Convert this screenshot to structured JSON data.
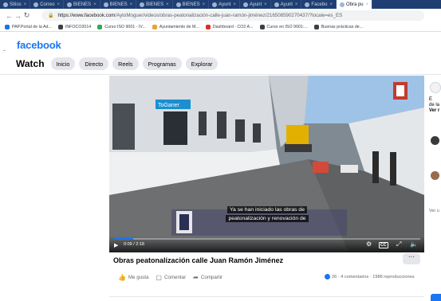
{
  "browser": {
    "tabs": [
      {
        "label": "Sitios",
        "active": false
      },
      {
        "label": "Correo",
        "active": false
      },
      {
        "label": "BIENES",
        "active": false
      },
      {
        "label": "BIENES",
        "active": false
      },
      {
        "label": "BIENES",
        "active": false
      },
      {
        "label": "BIENES",
        "active": false
      },
      {
        "label": "Ayunt",
        "active": false
      },
      {
        "label": "Ayunt",
        "active": false
      },
      {
        "label": "Ayunt",
        "active": false
      },
      {
        "label": "Facebo",
        "active": false
      },
      {
        "label": "Obra pu",
        "active": true
      }
    ],
    "url_host": "https://www.facebook.com",
    "url_path": "/AytoMoguer/videos/obras-peatonalización-calle-juan-ramón-jiménez/2165085902704​37/?locale=es_ES",
    "bookmarks": [
      {
        "label": "PAP.Portal de la Ad...",
        "color": "#1a73e8"
      },
      {
        "label": "INFOCO2014",
        "color": "#3c4043"
      },
      {
        "label": "Curso ISO 9001 - IV...",
        "color": "#34a853"
      },
      {
        "label": "Ayuntamiento de M...",
        "color": "#e8a33b"
      },
      {
        "label": "Dashboard - CO2 A...",
        "color": "#d93025"
      },
      {
        "label": "Curso en ISO 9001:...",
        "color": "#3c4043"
      },
      {
        "label": "Buenas prácticas de...",
        "color": "#3c4043"
      }
    ]
  },
  "facebook": {
    "logo": "facebook",
    "brand_color": "#1877f2"
  },
  "watch": {
    "title": "Watch",
    "tabs": [
      "Inicio",
      "Directo",
      "Reels",
      "Programas",
      "Explorar"
    ]
  },
  "video": {
    "subtitle_line1": "Ya se han iniciado las obras de",
    "subtitle_line2": "peatonalización y renovación de",
    "time": "0:09 / 2:18",
    "progress": 0.065,
    "title": "Obras peatonalización calle Juan Ramón Jiménez",
    "more_label": "···"
  },
  "actions": {
    "like": "Me gusta",
    "comment": "Comentar",
    "share": "Compartir"
  },
  "stats": {
    "text": "26 · 4 comentarios · 1988 reproducciones"
  },
  "rightcol": {
    "line1": "E",
    "line2": "de la",
    "line3": "Ver r",
    "bottom": "Ver u"
  }
}
